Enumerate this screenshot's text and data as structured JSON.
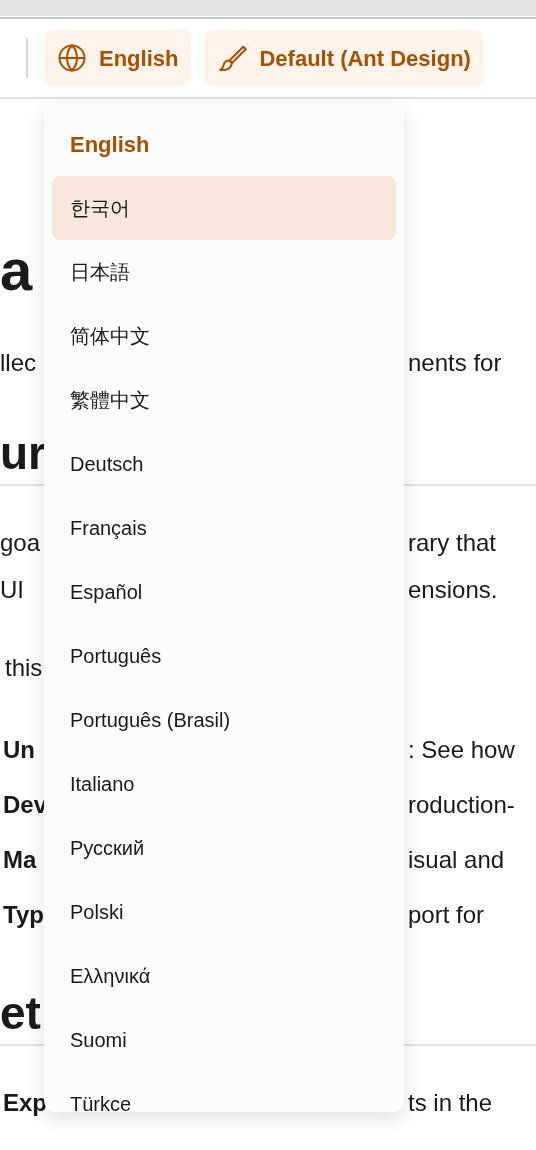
{
  "toolbar": {
    "buttons": [
      {
        "kind": "language",
        "label": "English"
      },
      {
        "kind": "theme",
        "label": "Default (Ant Design)"
      }
    ]
  },
  "content": {
    "title": "a",
    "intro": {
      "left": "llec",
      "right": "nents for"
    },
    "section_1": {
      "heading": "ur",
      "paragraph_lines": [
        {
          "left": "goa",
          "right": "rary that"
        },
        {
          "left": "UI",
          "right": "ensions."
        }
      ],
      "lead": "this",
      "items": [
        {
          "term": "Un",
          "text": ": See how"
        },
        {
          "term": "Dev",
          "text": "roduction-"
        },
        {
          "term": "Ma",
          "text": "isual and"
        },
        {
          "term": "Typ",
          "text": "port for"
        }
      ]
    },
    "section_2": {
      "heading": "et",
      "items": [
        {
          "term": "Exp",
          "text": "ts in the"
        }
      ]
    }
  },
  "language_menu": {
    "items": [
      {
        "label": "English",
        "selected": true,
        "highlighted": false
      },
      {
        "label": "한국어",
        "selected": false,
        "highlighted": true
      },
      {
        "label": "日本語",
        "selected": false,
        "highlighted": false
      },
      {
        "label": "简体中文",
        "selected": false,
        "highlighted": false
      },
      {
        "label": "繁體中文",
        "selected": false,
        "highlighted": false
      },
      {
        "label": "Deutsch",
        "selected": false,
        "highlighted": false
      },
      {
        "label": "Français",
        "selected": false,
        "highlighted": false
      },
      {
        "label": "Español",
        "selected": false,
        "highlighted": false
      },
      {
        "label": "Português",
        "selected": false,
        "highlighted": false
      },
      {
        "label": "Português (Brasil)",
        "selected": false,
        "highlighted": false
      },
      {
        "label": "Italiano",
        "selected": false,
        "highlighted": false
      },
      {
        "label": "Русский",
        "selected": false,
        "highlighted": false
      },
      {
        "label": "Polski",
        "selected": false,
        "highlighted": false
      },
      {
        "label": "Ελληνικά",
        "selected": false,
        "highlighted": false
      },
      {
        "label": "Suomi",
        "selected": false,
        "highlighted": false
      },
      {
        "label": "Türkce",
        "selected": false,
        "highlighted": false
      }
    ]
  }
}
